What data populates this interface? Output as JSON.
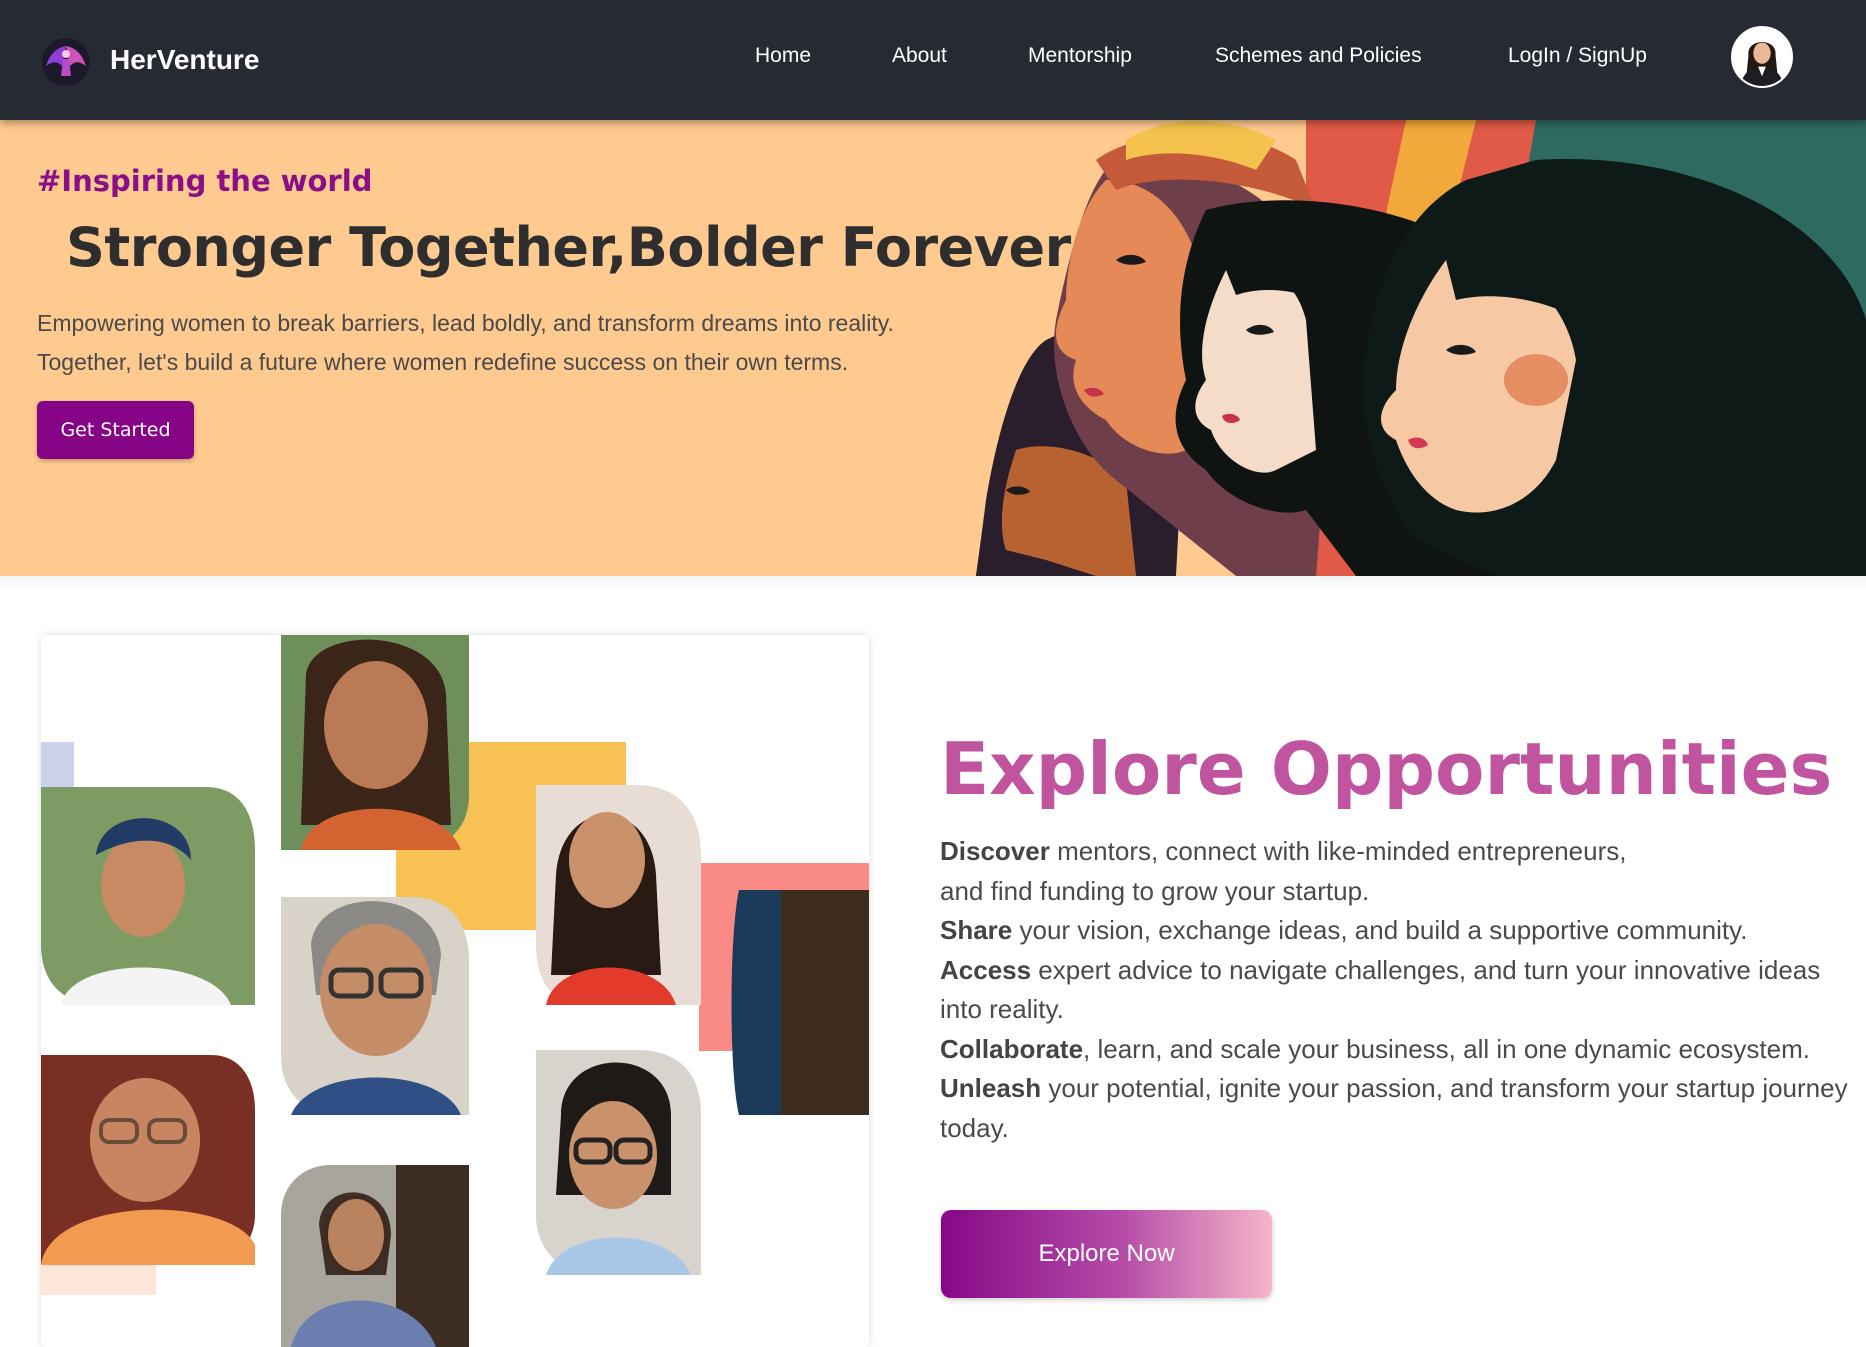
{
  "header": {
    "brand_name": "HerVenture",
    "logo_icon": "winged-woman-logo-icon",
    "nav": [
      {
        "label": "Home"
      },
      {
        "label": "About"
      },
      {
        "label": "Mentorship"
      },
      {
        "label": "Schemes and Policies"
      },
      {
        "label": "LogIn / SignUp"
      }
    ],
    "avatar_icon": "user-avatar-icon"
  },
  "hero": {
    "tag": "#Inspiring the world",
    "title": "Stronger Together,Bolder Forever",
    "line1": "Empowering women to break barriers, lead boldly, and transform dreams into reality.",
    "line2": "Together, let's build a future where women redefine success on their own terms.",
    "cta_label": "Get Started",
    "illustration": "women-profiles-illustration"
  },
  "explore": {
    "title": "Explore Opportunities",
    "lines": [
      {
        "bold": "Discover",
        "text": " mentors, connect with like-minded entrepreneurs,"
      },
      {
        "bold": "",
        "text": "and find funding to grow your startup."
      },
      {
        "bold": "Share",
        "text": " your vision, exchange ideas, and build a supportive community."
      },
      {
        "bold": "Access",
        "text": " expert advice to navigate challenges, and turn your innovative ideas"
      },
      {
        "bold": "",
        "text": "into reality."
      },
      {
        "bold": "Collaborate",
        "text": ", learn, and scale your business, all in one dynamic ecosystem."
      },
      {
        "bold": "Unleash",
        "text": " your potential, ignite your passion, and transform your startup journey"
      },
      {
        "bold": "",
        "text": "today."
      }
    ],
    "cta_label": "Explore Now",
    "collage": "women-entrepreneurs-photo-collage"
  },
  "colors": {
    "navbar": "#262a33",
    "hero_bg": "#ffca8f",
    "accent_purple": "#850485",
    "explore_title": "#c0549f"
  }
}
